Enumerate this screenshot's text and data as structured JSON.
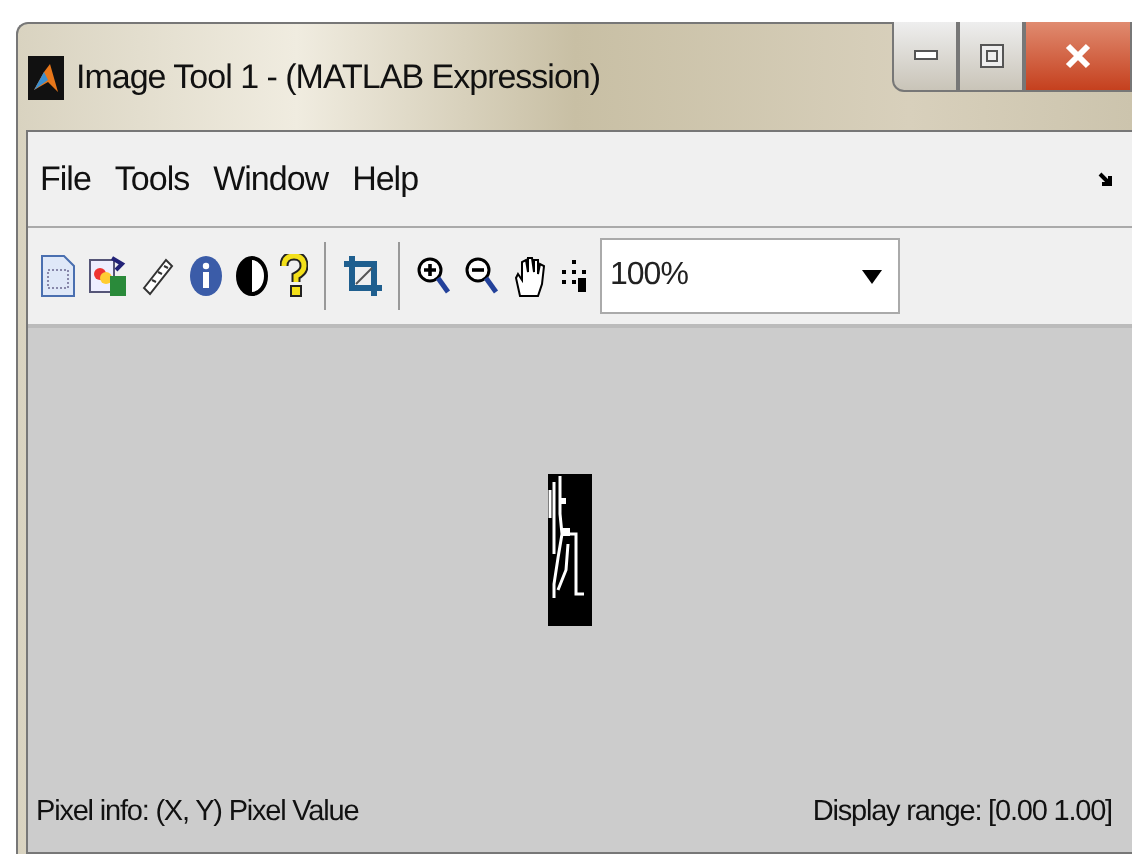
{
  "window": {
    "title": "Image Tool 1 - (MATLAB Expression)"
  },
  "menu": [
    {
      "label": "File"
    },
    {
      "label": "Tools"
    },
    {
      "label": "Window"
    },
    {
      "label": "Help"
    }
  ],
  "toolbar": {
    "zoom": {
      "value": "100%"
    }
  },
  "status_bar": {
    "pixel_info": "Pixel info: (X, Y)  Pixel Value",
    "display_range": "Display range: [0.00 1.00]"
  }
}
